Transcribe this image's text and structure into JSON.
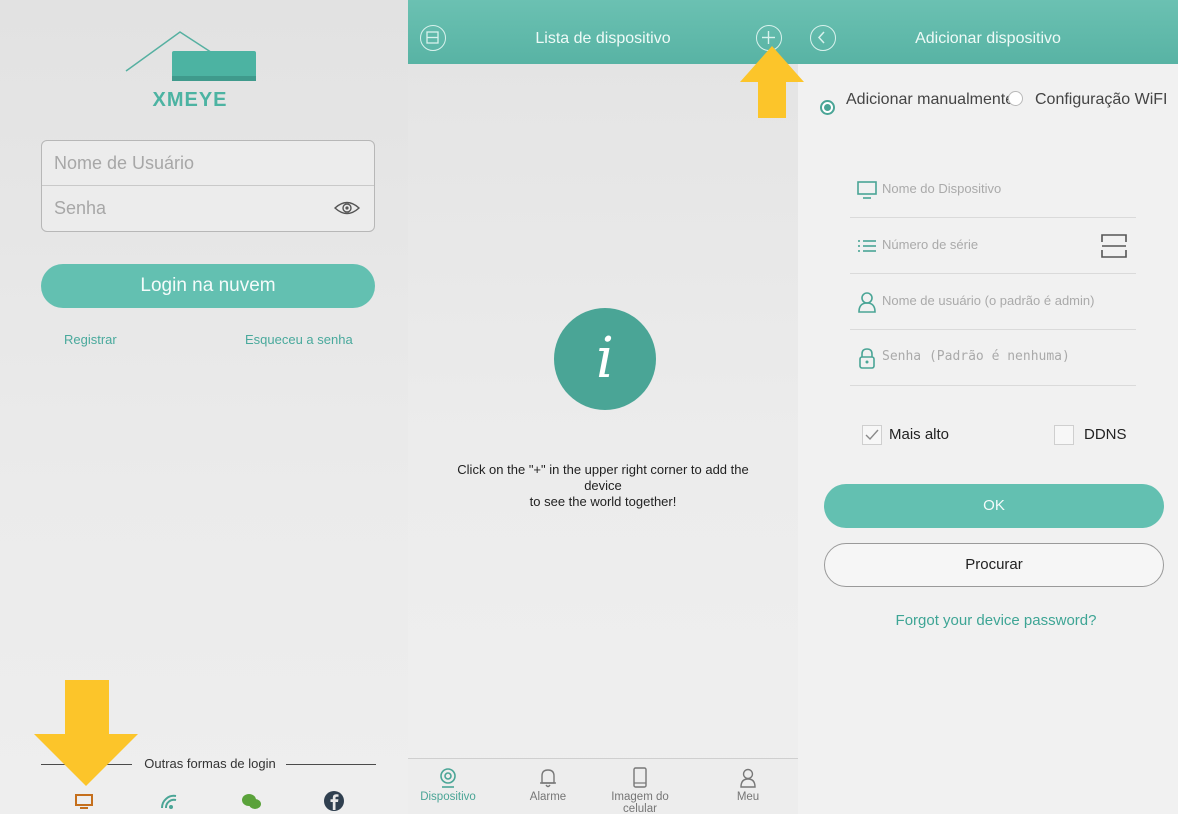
{
  "login": {
    "brand": "XMEYE",
    "username_placeholder": "Nome de Usuário",
    "password_placeholder": "Senha",
    "login_button": "Login na nuvem",
    "register_link": "Registrar",
    "forgot_link": "Esqueceu a senha",
    "other_login_label": "Outras formas de login",
    "social_icons": [
      "monitor-icon",
      "wifi-icon",
      "wechat-icon",
      "facebook-icon"
    ]
  },
  "device_list": {
    "title": "Lista de dispositivo",
    "empty_message_line1": "Click on the \"+\" in the upper right corner to add the",
    "empty_message_line2": "device",
    "empty_message_line3": "to see the world together!",
    "tabs": [
      {
        "label": "Dispositivo",
        "icon": "camera-icon",
        "active": true
      },
      {
        "label": "Alarme",
        "icon": "bell-icon",
        "active": false
      },
      {
        "label": "Imagem do celular",
        "icon": "phone-icon",
        "active": false
      },
      {
        "label": "Meu",
        "icon": "user-icon",
        "active": false
      }
    ]
  },
  "add_device": {
    "title": "Adicionar dispositivo",
    "mode_manual": "Adicionar manualmente",
    "mode_wifi": "Configuração WiFI",
    "device_name_placeholder": "Nome do Dispositivo",
    "serial_placeholder": "Número de série",
    "username_placeholder": "Nome de usuário (o padrão é admin)",
    "password_placeholder": "Senha (Padrão é nenhuma)",
    "option_higher": "Mais alto",
    "option_ddns": "DDNS",
    "ok_button": "OK",
    "search_button": "Procurar",
    "forgot_password_link": "Forgot your device password?"
  },
  "colors": {
    "accent": "#63c0b1",
    "accent_dark": "#4aa596",
    "highlight_arrow": "#fcc52a"
  }
}
